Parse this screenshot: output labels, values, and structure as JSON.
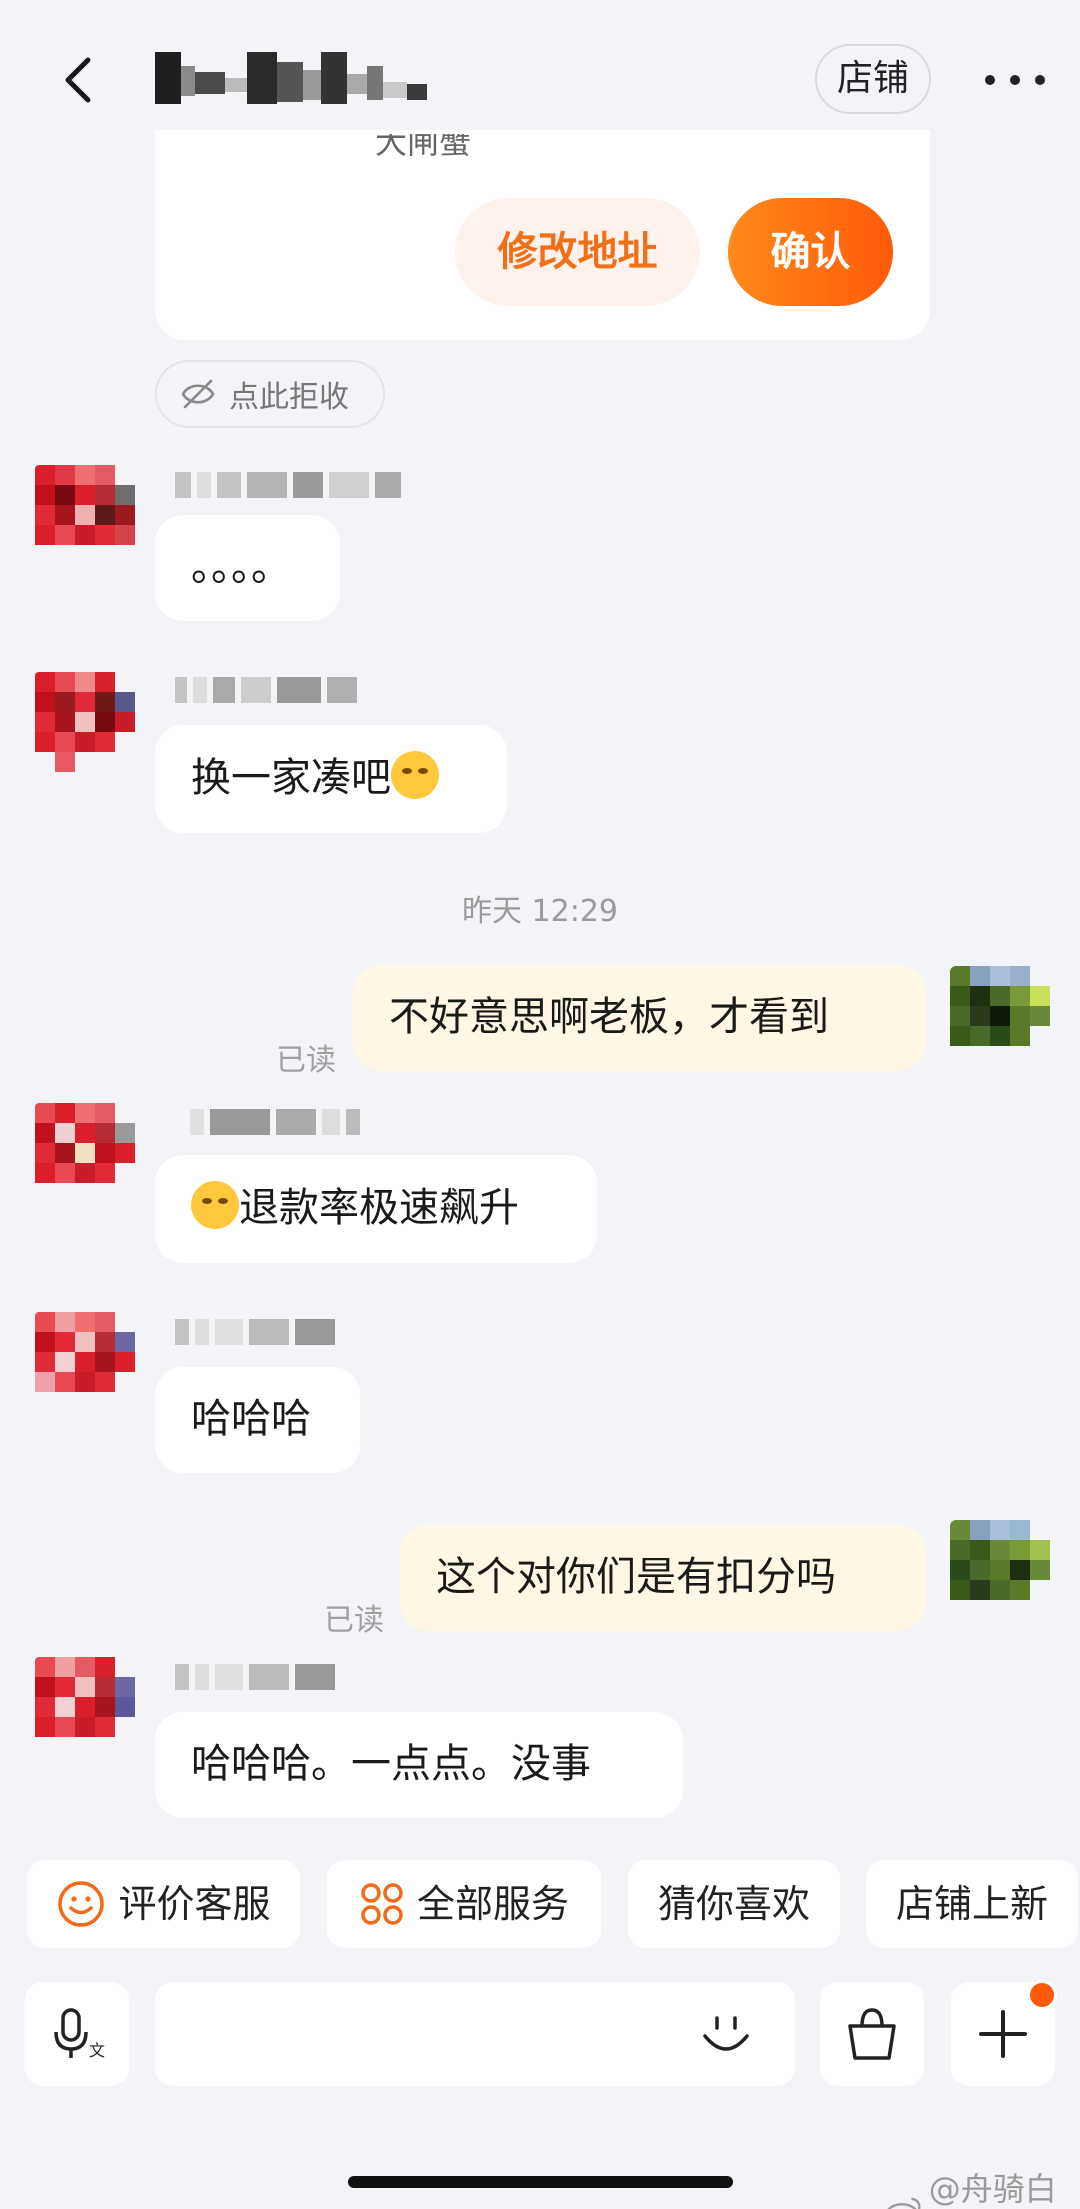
{
  "header": {
    "shop_label": "店铺"
  },
  "address_card": {
    "clipped_text": "大闸蟹",
    "modify_label": "修改地址",
    "confirm_label": "确认"
  },
  "reject_chip": {
    "label": "点此拒收"
  },
  "timestamp": "昨天 12:29",
  "messages": [
    {
      "text": "。。。。"
    },
    {
      "text": "换一家凑吧"
    },
    {
      "text": "不好意思啊老板，才看到",
      "read": "已读"
    },
    {
      "text": "退款率极速飙升"
    },
    {
      "text": "哈哈哈"
    },
    {
      "text": "这个对你们是有扣分吗",
      "read": "已读"
    },
    {
      "text": "哈哈哈。一点点。没事"
    }
  ],
  "quick_actions": [
    {
      "label": "评价客服",
      "icon": "smile-icon"
    },
    {
      "label": "全部服务",
      "icon": "grid-icon"
    },
    {
      "label": "猜你喜欢"
    },
    {
      "label": "店铺上新"
    }
  ],
  "input_bar": {
    "placeholder": ""
  },
  "watermark": "@舟骑白马",
  "colors": {
    "accent": "#ff6a0f",
    "mine_bubble": "#fff7e6",
    "background": "#f3f4f7"
  }
}
